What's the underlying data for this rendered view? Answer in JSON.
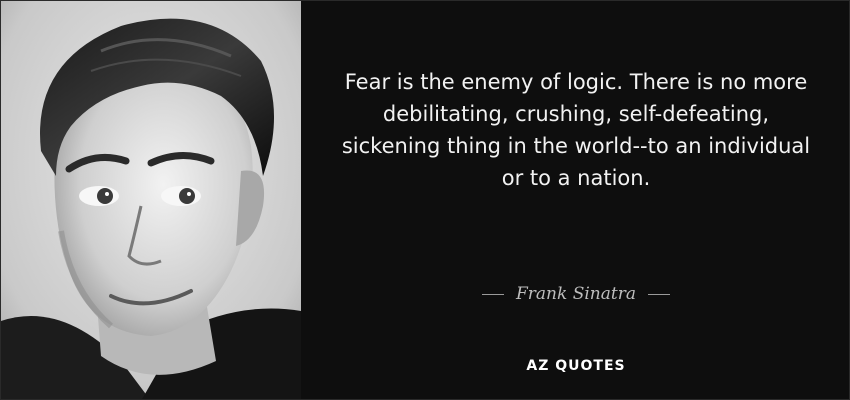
{
  "quote": {
    "text": "Fear is the enemy of logic. There is no more debilitating, crushing, self-defeating, sickening thing in the world--to an individual or to a nation.",
    "author": "Frank Sinatra"
  },
  "brand": {
    "logo_text": "AZ QUOTES"
  },
  "colors": {
    "background": "#0e0e0e",
    "quote_text": "#f2f2f2",
    "author_text": "#bdbdbd"
  }
}
